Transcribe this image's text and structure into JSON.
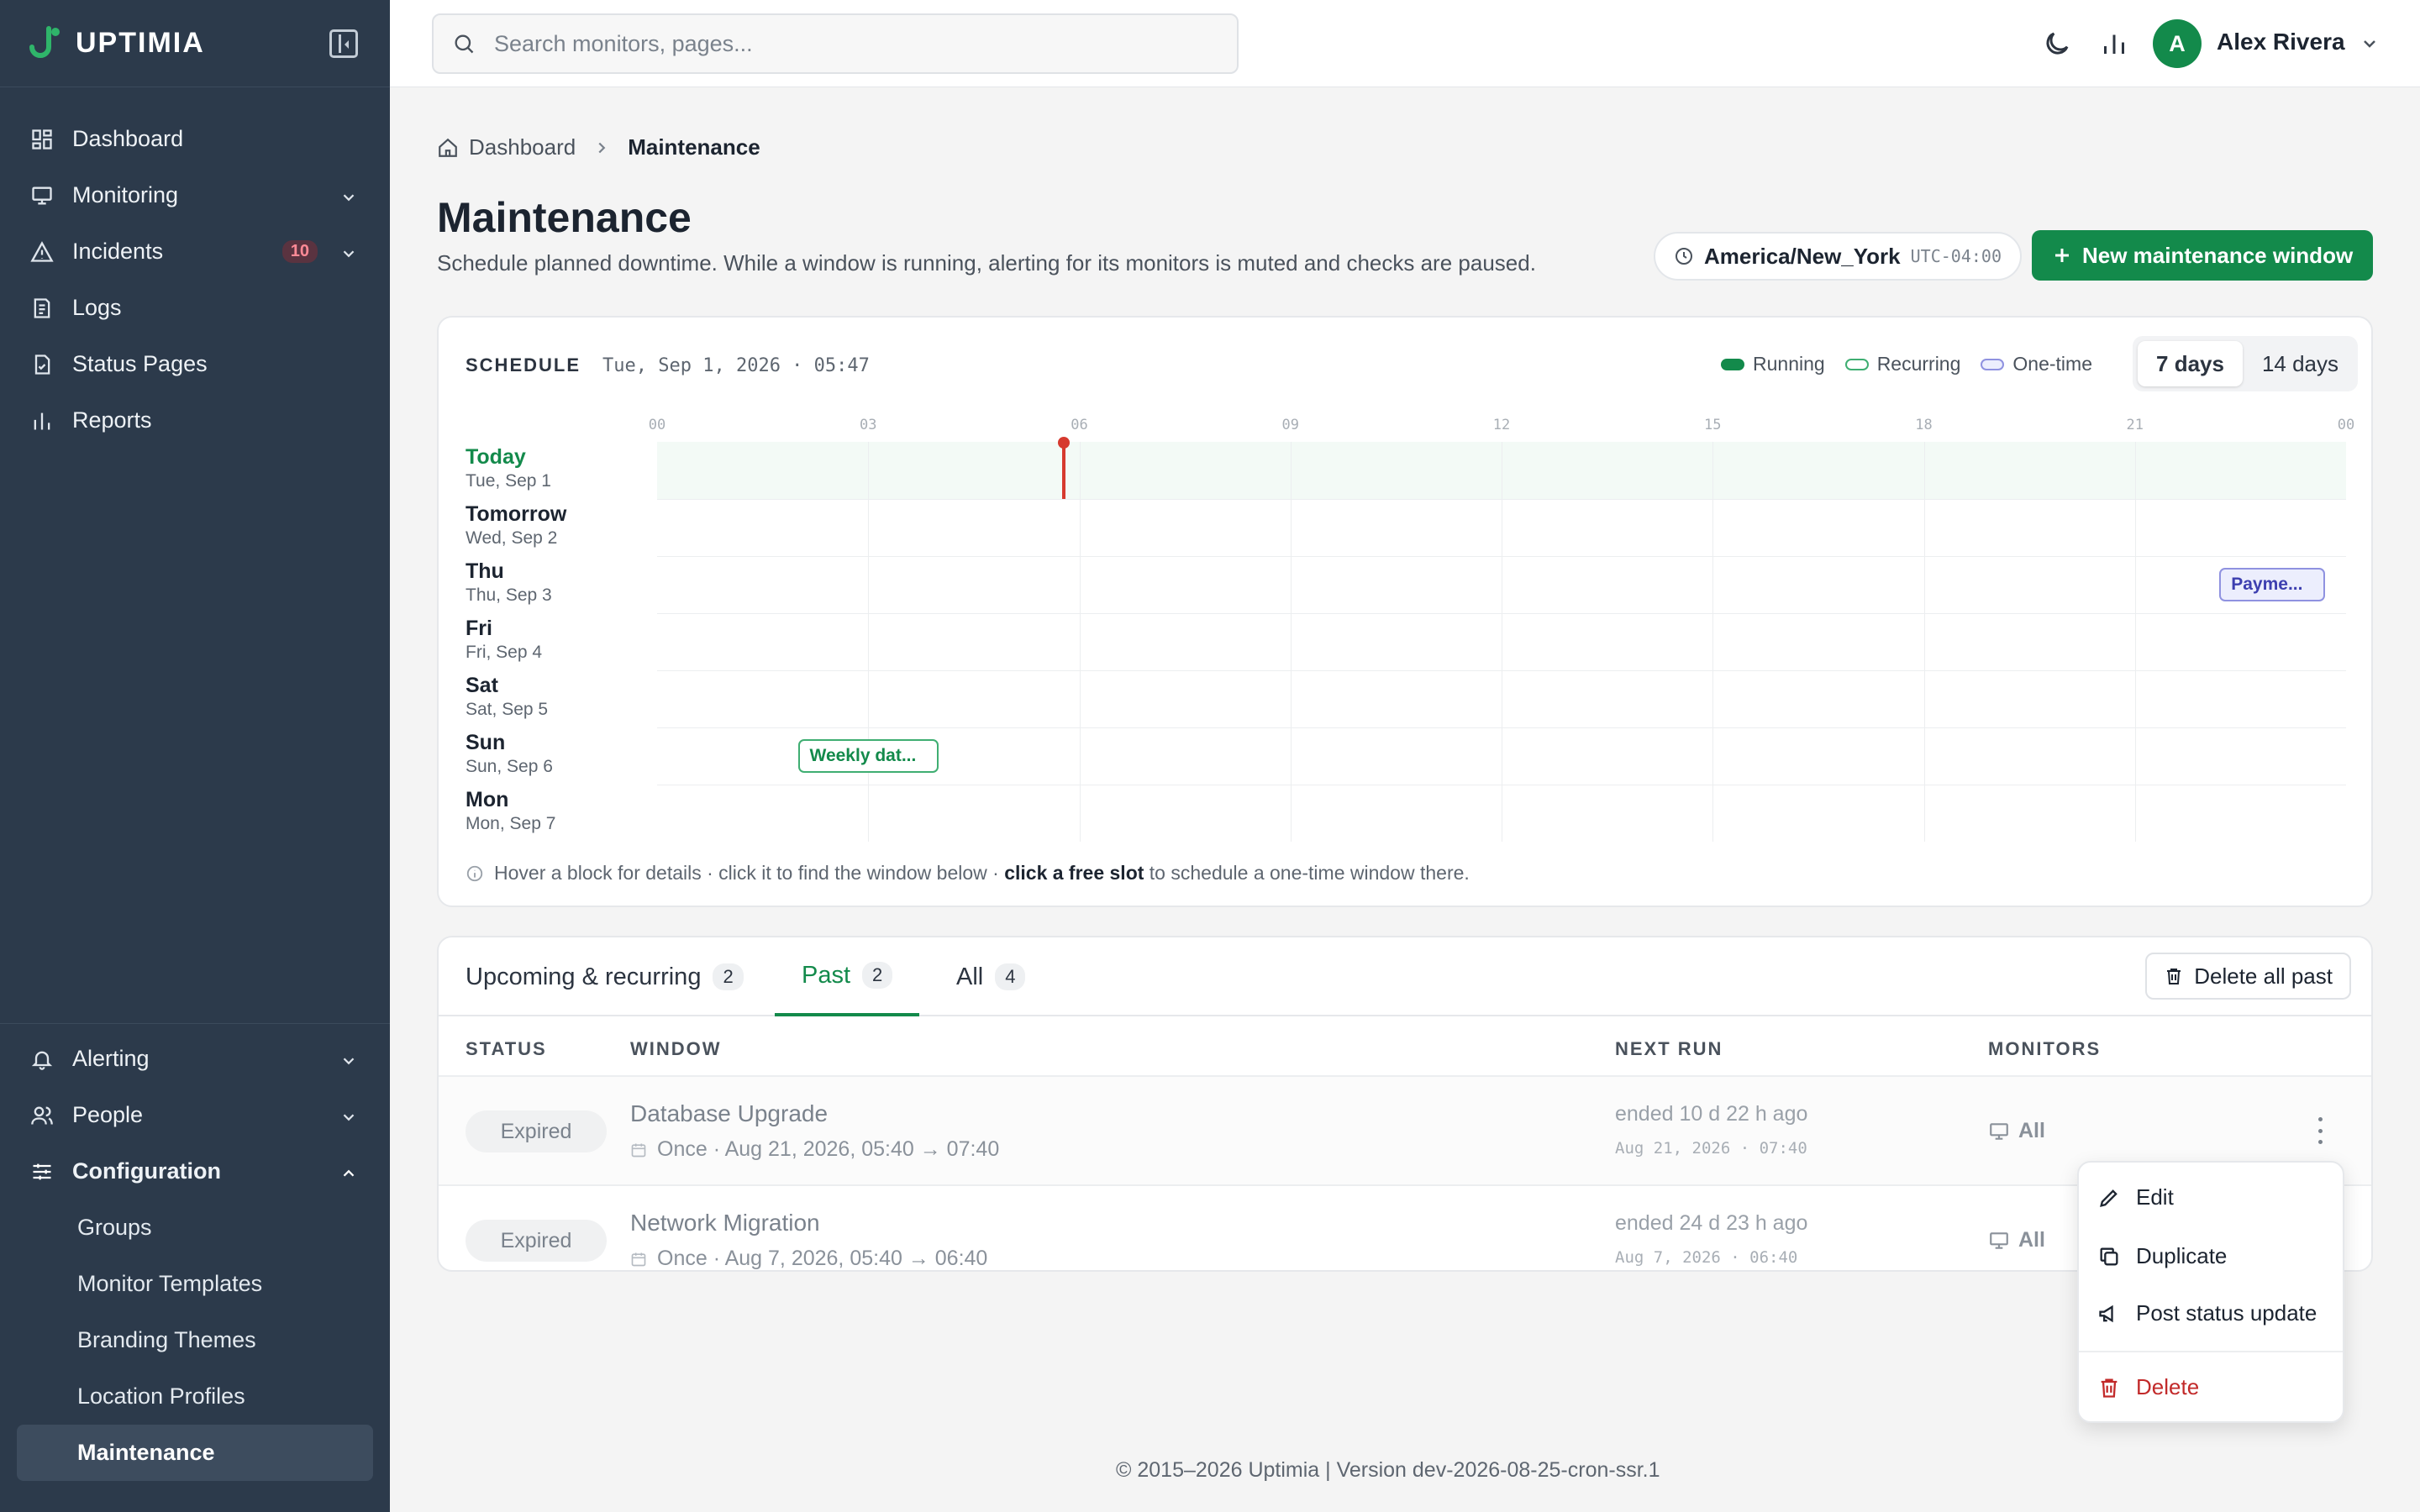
{
  "app": {
    "name": "UPTIMIA"
  },
  "search": {
    "placeholder": "Search monitors, pages..."
  },
  "user": {
    "initial": "A",
    "name": "Alex Rivera"
  },
  "sidebar": {
    "items": [
      {
        "label": "Dashboard",
        "icon": "dashboard-icon"
      },
      {
        "label": "Monitoring",
        "icon": "monitor-icon"
      },
      {
        "label": "Incidents",
        "icon": "alert-triangle-icon",
        "badge": "10"
      },
      {
        "label": "Logs",
        "icon": "logs-icon"
      },
      {
        "label": "Status Pages",
        "icon": "status-page-icon"
      },
      {
        "label": "Reports",
        "icon": "bar-chart-icon"
      }
    ],
    "bottom": [
      {
        "label": "Alerting",
        "icon": "bell-icon"
      },
      {
        "label": "People",
        "icon": "people-icon"
      },
      {
        "label": "Configuration",
        "icon": "sliders-icon"
      }
    ],
    "config_sub": [
      "Groups",
      "Monitor Templates",
      "Branding Themes",
      "Location Profiles",
      "Maintenance"
    ]
  },
  "breadcrumb": {
    "home": "Dashboard",
    "current": "Maintenance"
  },
  "page": {
    "title": "Maintenance",
    "subtitle": "Schedule planned downtime. While a window is running, alerting for its monitors is muted and checks are paused.",
    "timezone": "America/New_York",
    "utc_offset": "UTC-04:00",
    "new_button": "New maintenance window"
  },
  "schedule": {
    "label": "SCHEDULE",
    "now": "Tue, Sep 1, 2026 · 05:47",
    "legend": [
      "Running",
      "Recurring",
      "One-time"
    ],
    "legend_colors": {
      "running": "#138a4b",
      "recurring": "#3fae72",
      "onetime": "#8f92e0"
    },
    "range_options": [
      "7 days",
      "14 days"
    ],
    "selected_range": "7 days",
    "hour_ticks": [
      "00",
      "03",
      "06",
      "09",
      "12",
      "15",
      "18",
      "21",
      "00"
    ],
    "now_hour": 5.78,
    "days": [
      {
        "name": "Today",
        "date": "Tue, Sep 1"
      },
      {
        "name": "Tomorrow",
        "date": "Wed, Sep 2"
      },
      {
        "name": "Thu",
        "date": "Thu, Sep 3"
      },
      {
        "name": "Fri",
        "date": "Fri, Sep 4"
      },
      {
        "name": "Sat",
        "date": "Sat, Sep 5"
      },
      {
        "name": "Sun",
        "date": "Sun, Sep 6"
      },
      {
        "name": "Mon",
        "date": "Mon, Sep 7"
      }
    ],
    "blocks": [
      {
        "label": "Payme...",
        "day": 2,
        "start_hour": 22.2,
        "end_hour": 23.7,
        "kind": "onetime"
      },
      {
        "label": "Weekly dat...",
        "day": 5,
        "start_hour": 2.0,
        "end_hour": 4.0,
        "kind": "recur"
      }
    ],
    "hint_pre": "Hover a block for details · click it to find the window below · ",
    "hint_bold": "click a free slot",
    "hint_post": " to schedule a one-time window there."
  },
  "tabs": [
    {
      "label": "Upcoming & recurring",
      "count": "2"
    },
    {
      "label": "Past",
      "count": "2"
    },
    {
      "label": "All",
      "count": "4"
    }
  ],
  "delete_all": "Delete all past",
  "table": {
    "headers": [
      "STATUS",
      "WINDOW",
      "NEXT RUN",
      "MONITORS"
    ],
    "rows": [
      {
        "status": "Expired",
        "name": "Database Upgrade",
        "meta": "Once · Aug 21, 2026, 05:40 → 07:40",
        "next": "ended 10 d 22 h ago",
        "next_ts": "Aug 21, 2026 · 07:40",
        "monitors": "All"
      },
      {
        "status": "Expired",
        "name": "Network Migration",
        "meta": "Once · Aug 7, 2026, 05:40 → 06:40",
        "next": "ended 24 d 23 h ago",
        "next_ts": "Aug 7, 2026 · 06:40",
        "monitors": "All"
      }
    ]
  },
  "menu": [
    "Edit",
    "Duplicate",
    "Post status update",
    "Delete"
  ],
  "footer": "© 2015–2026 Uptimia  |  Version dev-2026-08-25-cron-ssr.1"
}
